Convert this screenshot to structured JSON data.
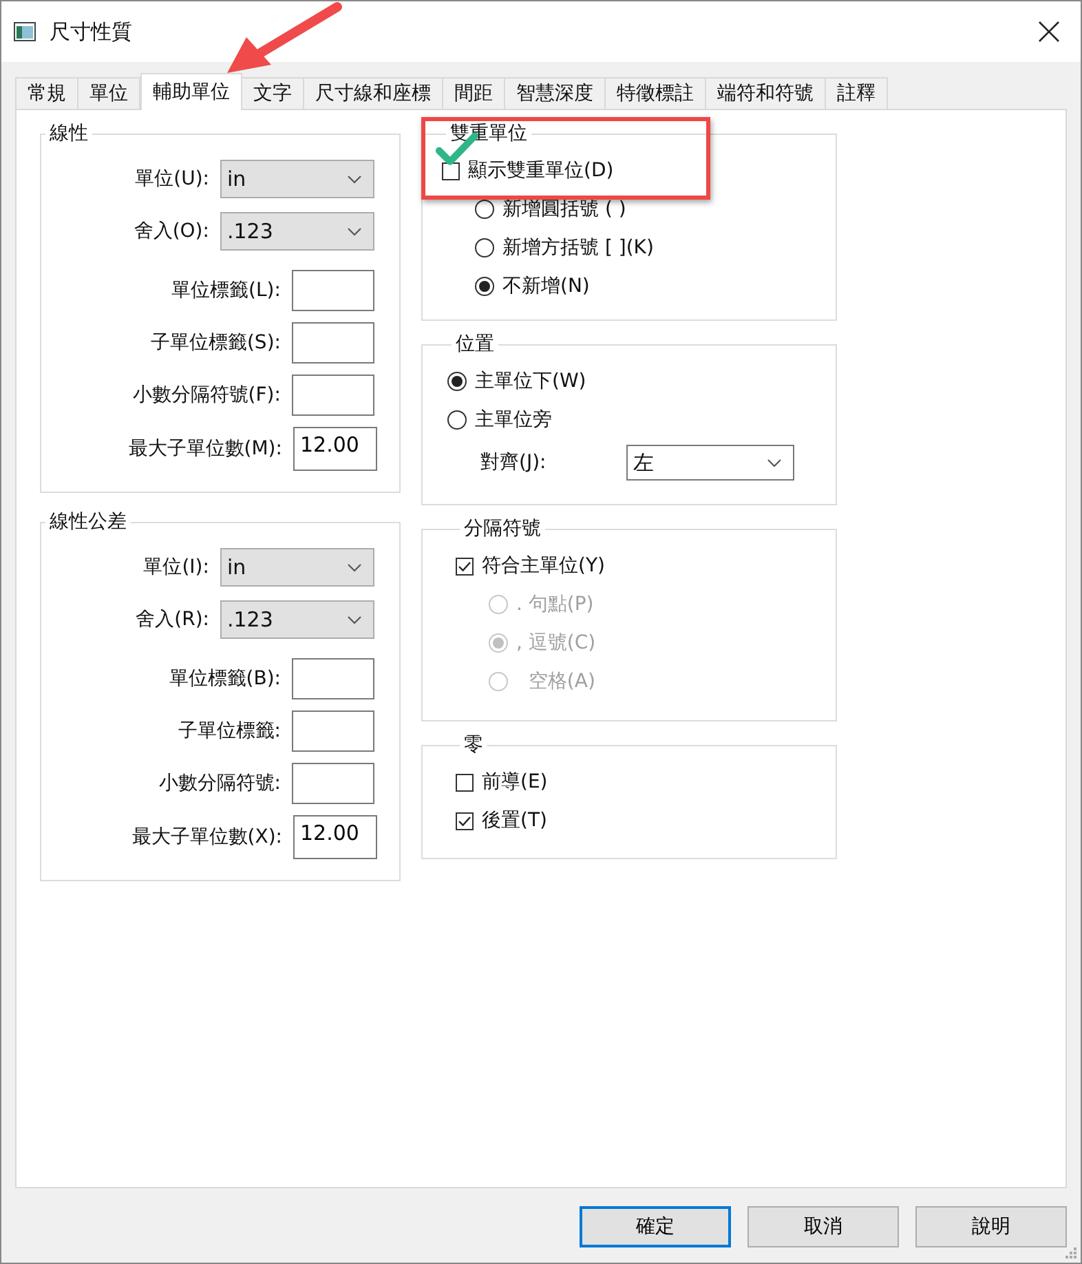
{
  "window": {
    "title": "尺寸性質"
  },
  "tabs": [
    {
      "label": "常規",
      "selected": false
    },
    {
      "label": "單位",
      "selected": false
    },
    {
      "label": "輔助單位",
      "selected": true
    },
    {
      "label": "文字",
      "selected": false
    },
    {
      "label": "尺寸線和座標",
      "selected": false
    },
    {
      "label": "間距",
      "selected": false
    },
    {
      "label": "智慧深度",
      "selected": false
    },
    {
      "label": "特徵標註",
      "selected": false
    },
    {
      "label": "端符和符號",
      "selected": false
    },
    {
      "label": "註釋",
      "selected": false
    }
  ],
  "left_groups": [
    {
      "title": "線性",
      "rows": [
        {
          "kind": "dropdown",
          "label": "單位(U):",
          "value": "in"
        },
        {
          "kind": "dropdown",
          "label": "舍入(O):",
          "value": ".123"
        },
        {
          "kind": "text",
          "label": "單位標籤(L):"
        },
        {
          "kind": "text",
          "label": "子單位標籤(S):"
        },
        {
          "kind": "text",
          "label": "小數分隔符號(F):"
        },
        {
          "kind": "text",
          "label": "最大子單位數(M):",
          "value": "12.00"
        }
      ]
    },
    {
      "title": "線性公差",
      "rows": [
        {
          "kind": "dropdown",
          "label": "單位(I):",
          "value": "in"
        },
        {
          "kind": "dropdown",
          "label": "舍入(R):",
          "value": ".123"
        },
        {
          "kind": "text",
          "label": "單位標籤(B):"
        },
        {
          "kind": "text",
          "label": "子單位標籤:"
        },
        {
          "kind": "text",
          "label": "小數分隔符號:"
        },
        {
          "kind": "text",
          "label": "最大子單位數(X):",
          "value": "12.00"
        }
      ]
    }
  ],
  "right_groups": [
    {
      "title": "雙重單位",
      "items": [
        {
          "kind": "checkbox",
          "label": "顯示雙重單位(D)",
          "checked": false,
          "children": [
            {
              "kind": "radio",
              "label": "新增圓括號 ( )",
              "selected": false,
              "disabled": false
            },
            {
              "kind": "radio",
              "label": "新增方括號 [ ](K)",
              "selected": false,
              "disabled": false
            },
            {
              "kind": "radio",
              "label": "不新增(N)",
              "selected": true,
              "disabled": false
            }
          ]
        }
      ]
    },
    {
      "title": "位置",
      "items": [
        {
          "kind": "radio",
          "label": "主單位下(W)",
          "selected": true,
          "disabled": false
        },
        {
          "kind": "radio",
          "label": "主單位旁",
          "selected": false,
          "disabled": false,
          "children": [
            {
              "kind": "dropdown",
              "label": "對齊(J):",
              "value": "左"
            }
          ]
        }
      ]
    },
    {
      "title": "分隔符號",
      "items": [
        {
          "kind": "checkbox",
          "label": "符合主單位(Y)",
          "checked": true,
          "children": [
            {
              "kind": "radio",
              "label": ". 句點(P)",
              "selected": false,
              "disabled": true
            },
            {
              "kind": "radio",
              "label": ", 逗號(C)",
              "selected": true,
              "disabled": true
            },
            {
              "kind": "radio",
              "label": "  空格(A)",
              "selected": false,
              "disabled": true
            }
          ]
        }
      ]
    },
    {
      "title": "零",
      "items": [
        {
          "kind": "checkbox",
          "label": "前導(E)",
          "checked": false
        },
        {
          "kind": "checkbox",
          "label": "後置(T)",
          "checked": true
        }
      ]
    }
  ],
  "buttons": [
    {
      "label": "確定",
      "default": true
    },
    {
      "label": "取消",
      "default": false
    },
    {
      "label": "說明",
      "default": false
    }
  ]
}
